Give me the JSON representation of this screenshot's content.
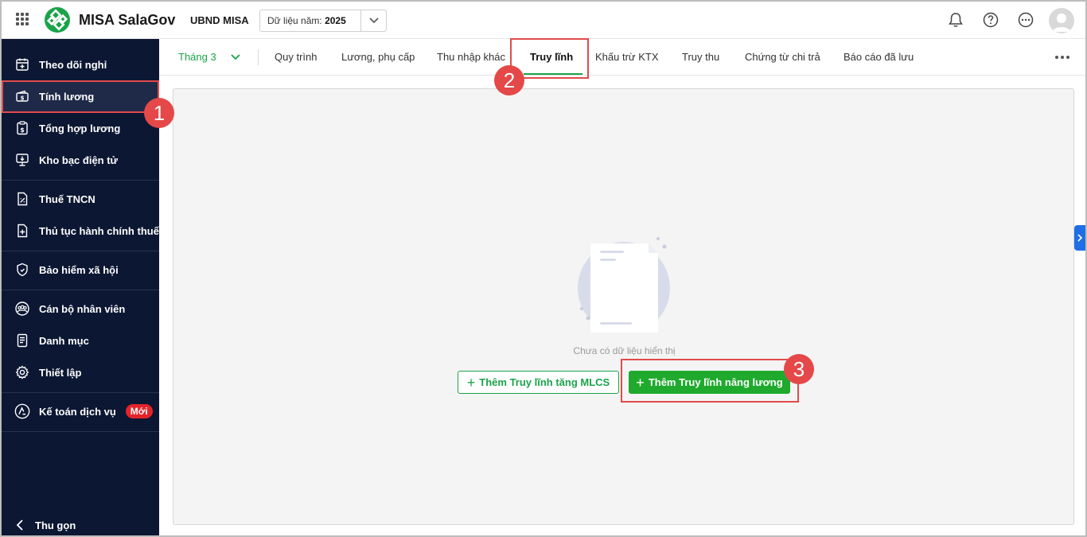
{
  "header": {
    "app_title": "MISA SalaGov",
    "org_name": "UBND MISA",
    "year_label": "Dữ liệu năm:",
    "year_value": "2025"
  },
  "sidebar": {
    "items": [
      {
        "label": "Theo dõi nghỉ",
        "icon": "calendar-plus-icon"
      },
      {
        "label": "Tính lương",
        "icon": "wallet-icon"
      },
      {
        "label": "Tổng hợp lương",
        "icon": "clipboard-dollar-icon"
      },
      {
        "label": "Kho bạc điện tử",
        "icon": "monitor-download-icon"
      },
      {
        "label": "Thuế TNCN",
        "icon": "tax-document-icon"
      },
      {
        "label": "Thủ tục hành chính thuế",
        "icon": "document-add-icon"
      },
      {
        "label": "Bảo hiểm xã hội",
        "icon": "shield-icon"
      },
      {
        "label": "Cán bộ nhân viên",
        "icon": "people-icon"
      },
      {
        "label": "Danh mục",
        "icon": "list-document-icon"
      },
      {
        "label": "Thiết lập",
        "icon": "gear-icon"
      },
      {
        "label": "Kế toán dịch vụ",
        "icon": "accounting-icon",
        "badge": "Mới"
      }
    ],
    "collapse_label": "Thu gọn"
  },
  "tabs": {
    "month": "Tháng 3",
    "items": [
      "Quy trình",
      "Lương, phụ cấp",
      "Thu nhập khác",
      "Truy lĩnh",
      "Khấu trừ KTX",
      "Truy thu",
      "Chứng từ chi trả",
      "Báo cáo đã lưu"
    ],
    "active": "Truy lĩnh"
  },
  "content": {
    "empty_text": "Chưa có dữ liệu hiển thị",
    "btn_add_mlcs": "Thêm Truy lĩnh tăng MLCS",
    "btn_add_raise": "Thêm Truy lĩnh nâng lương"
  },
  "annotations": [
    "1",
    "2",
    "3"
  ],
  "colors": {
    "accent_green": "#1aa34a",
    "sidebar_bg": "#0c1733",
    "annotation_red": "#e54848",
    "badge_red": "#e5242a"
  }
}
